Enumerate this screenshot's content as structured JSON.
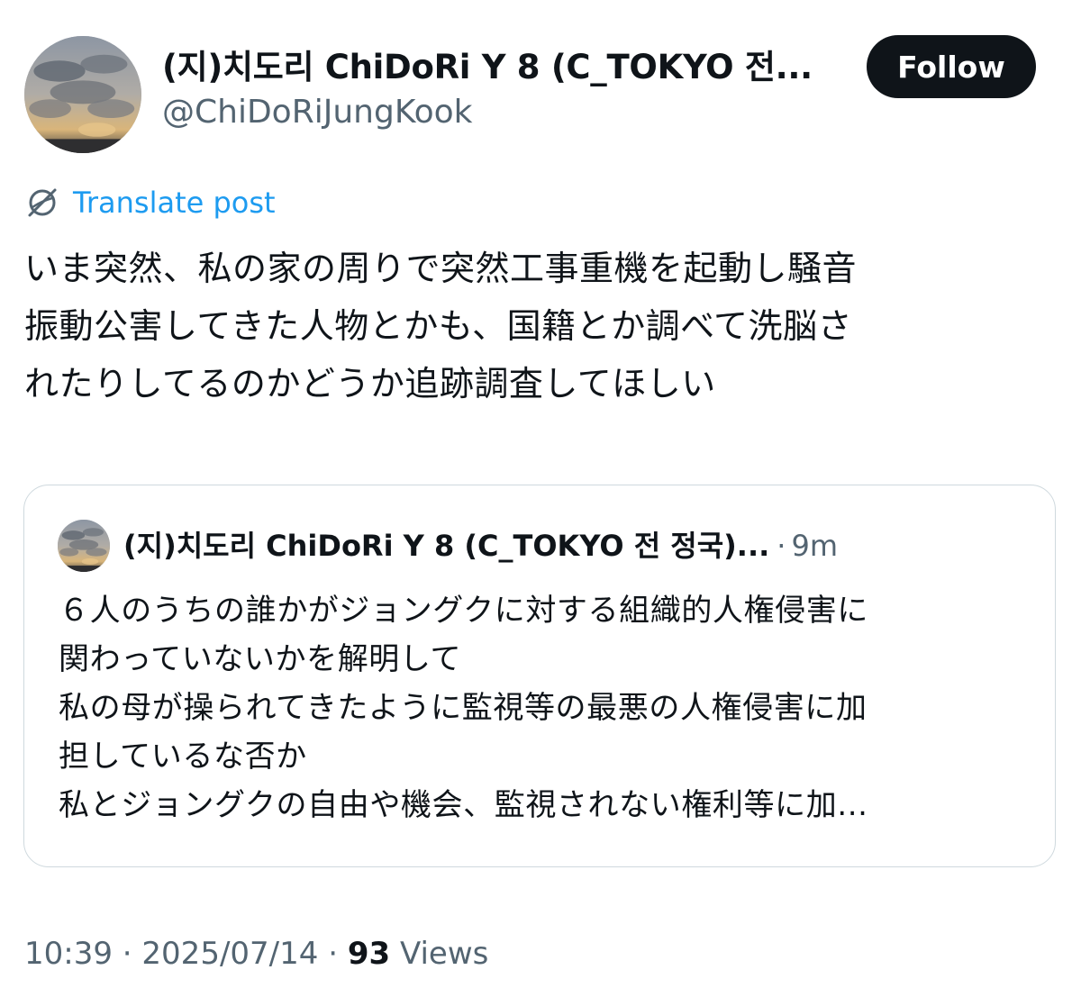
{
  "author": {
    "display_name": "(지)치도리 ChiDoRi Y 8 (C_TOKYO 전...",
    "handle": "@ChiDoRiJungKook",
    "avatar_icon": "sky-clouds-avatar"
  },
  "follow_label": "Follow",
  "translate": {
    "icon": "translate-globe-icon",
    "label": "Translate post"
  },
  "post_lines": [
    "いま突然、私の家の周りで突然工事重機を起動し騒音",
    "振動公害してきた人物とかも、国籍とか調べて洗脳さ",
    "れたりしてるのかどうか追跡調査してほしい"
  ],
  "quote": {
    "author_name": "(지)치도리 ChiDoRi Y 8 (C_TOKYO 전 정국)...",
    "separator": "·",
    "time": "9m",
    "lines": [
      "６人のうちの誰かがジョングクに対する組織的人権侵害に",
      "関わっていないかを解明して",
      "私の母が操られてきたように監視等の最悪の人権侵害に加",
      "担しているな否か",
      "私とジョングクの自由や機会、監視されない権利等に加..."
    ]
  },
  "meta": {
    "time": "10:39",
    "date": "2025/07/14",
    "separator": "·",
    "views_count": "93",
    "views_label": "Views"
  },
  "colors": {
    "text": "#0f1419",
    "secondary": "#536471",
    "link": "#1d9bf0",
    "border": "#cfd9de",
    "button_bg": "#0f1419"
  }
}
